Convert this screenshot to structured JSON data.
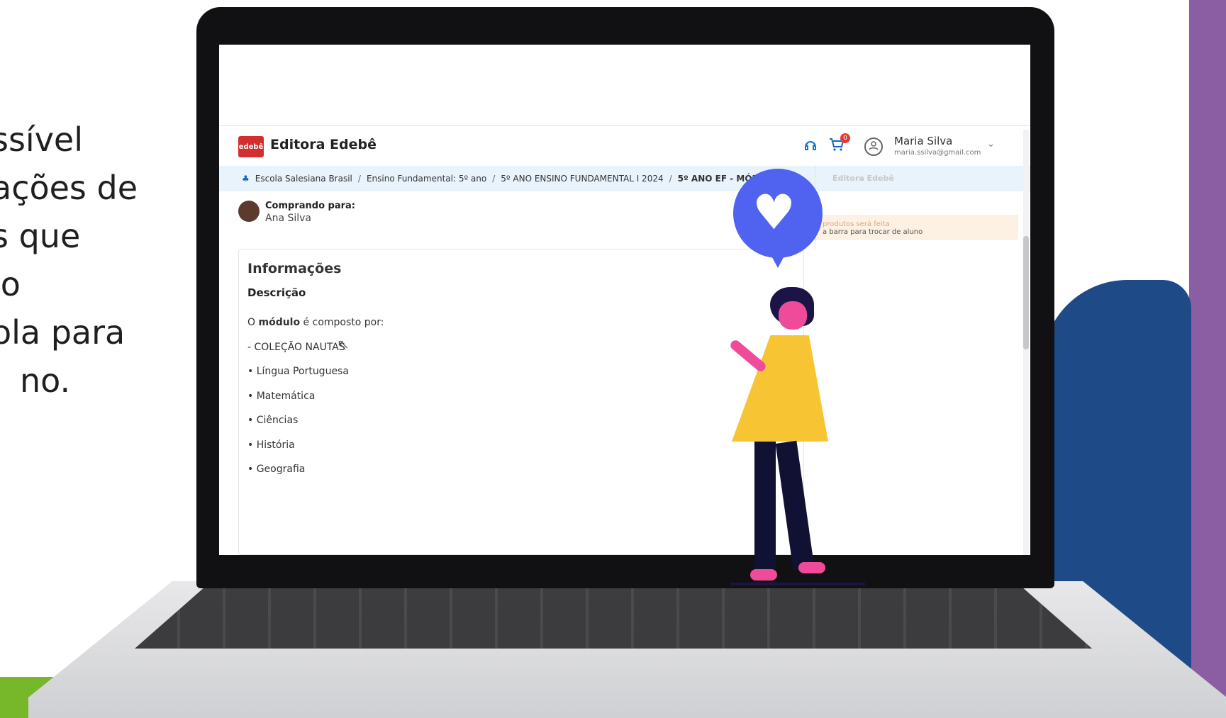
{
  "side_text": {
    "lines": [
      "ssível",
      "ações de",
      "s que",
      "lo",
      "ola para",
      "no."
    ]
  },
  "app": {
    "brand_logo_text": "edebê",
    "brand_name": "Editora Edebê"
  },
  "header": {
    "cart_count": "0",
    "user_name": "Maria Silva",
    "user_email": "maria.ssilva@gmail.com"
  },
  "breadcrumb": {
    "items": [
      "Escola Salesiana Brasil",
      "Ensino Fundamental: 5º ano",
      "5º ANO ENSINO FUNDAMENTAL I 2024",
      "5º ANO EF - MÓDULO 1"
    ]
  },
  "buyer": {
    "label": "Comprando para:",
    "name": "Ana Silva"
  },
  "info": {
    "title": "Informações",
    "description_title": "Descrição",
    "intro_prefix": "O ",
    "intro_bold": "módulo",
    "intro_suffix": " é composto por:",
    "items": [
      "- COLEÇÃO NAUTAS",
      "• Língua Portuguesa",
      "• Matemática",
      "• Ciências",
      "• História",
      "• Geografia"
    ]
  },
  "side_panel": {
    "header": "Editora Edebê",
    "notice_line1": "produtos será feita",
    "notice_line2": "a barra para trocar de aluno"
  },
  "colors": {
    "brand_red": "#d32f2f",
    "breadcrumb_bg": "#e8f3fc",
    "heart_bubble": "#4f63f0",
    "purple": "#8b5ea3",
    "blue": "#1e4a87",
    "green": "#76b82a"
  }
}
